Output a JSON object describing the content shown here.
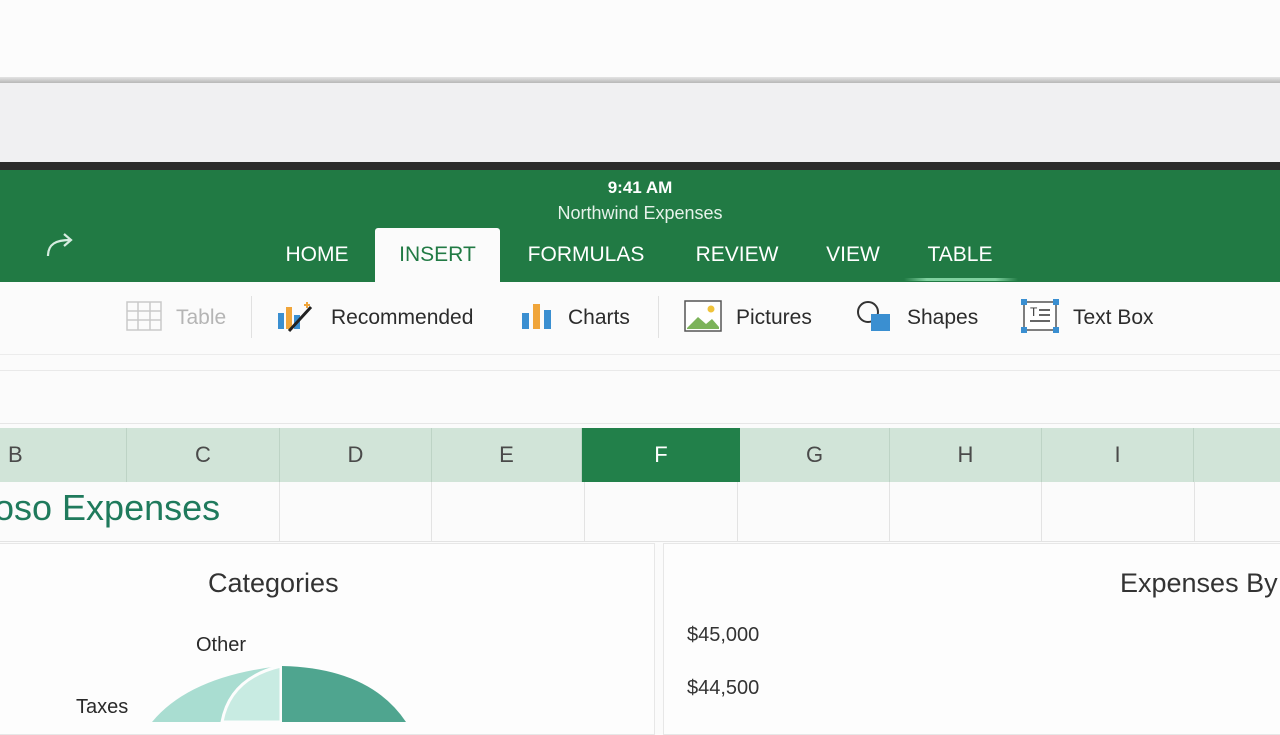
{
  "status": {
    "time": "9:41 AM"
  },
  "document": {
    "title": "Northwind Expenses"
  },
  "tabs": [
    {
      "label": "HOME"
    },
    {
      "label": "INSERT"
    },
    {
      "label": "FORMULAS"
    },
    {
      "label": "REVIEW"
    },
    {
      "label": "VIEW"
    },
    {
      "label": "TABLE"
    }
  ],
  "ribbon": {
    "table": "Table",
    "recommended": "Recommended",
    "charts": "Charts",
    "pictures": "Pictures",
    "shapes": "Shapes",
    "textbox": "Text Box"
  },
  "columns": [
    "B",
    "C",
    "D",
    "E",
    "F",
    "G",
    "H",
    "I"
  ],
  "selected_column": "F",
  "sheet": {
    "title": "oso Expenses"
  },
  "chart_left": {
    "title": "Categories",
    "labels": [
      "Other",
      "Taxes"
    ]
  },
  "chart_right": {
    "title": "Expenses By",
    "yticks": [
      "$45,000",
      "$44,500"
    ]
  },
  "colors": {
    "accent_green": "#217a44",
    "selected_column": "#22804a",
    "header_bg": "#d1e4d8",
    "sheet_title": "#1f7a5c"
  }
}
